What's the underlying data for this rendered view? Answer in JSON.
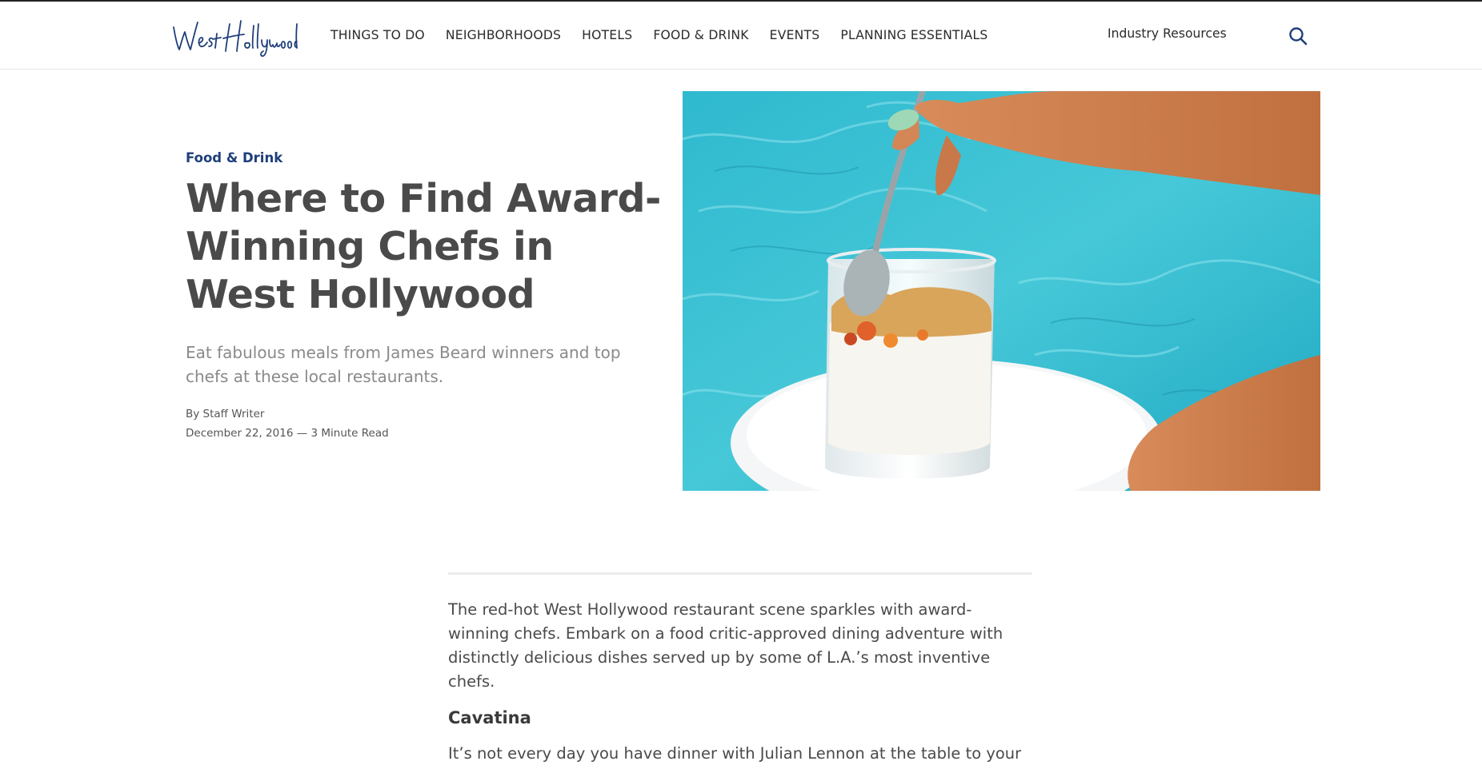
{
  "brand": {
    "logo_text": "West Hollywood",
    "accent": "#1f3f7a"
  },
  "nav": {
    "items": [
      {
        "label": "THINGS TO DO"
      },
      {
        "label": "NEIGHBORHOODS"
      },
      {
        "label": "HOTELS"
      },
      {
        "label": "FOOD & DRINK"
      },
      {
        "label": "EVENTS"
      },
      {
        "label": "PLANNING ESSENTIALS"
      }
    ],
    "industry_label": "Industry Resources",
    "search_icon": "search-icon"
  },
  "hero": {
    "category": "Food & Drink",
    "title": "Where to Find Award-Winning Chefs in West Hollywood",
    "subtitle": "Eat fabulous meals from James Beard winners and top chefs at these local restaurants.",
    "byline": "By Staff Writer",
    "dateline": "December 22, 2016 — 3 Minute Read"
  },
  "article": {
    "intro": "The red-hot West Hollywood restaurant scene sparkles with award-winning chefs. Embark on a food critic-approved dining adventure with distinctly delicious dishes served up by some of L.A.’s most inventive chefs.",
    "section_heading": "Cavatina",
    "section_text": "It’s not every day you have dinner with Julian Lennon at the table to your"
  }
}
